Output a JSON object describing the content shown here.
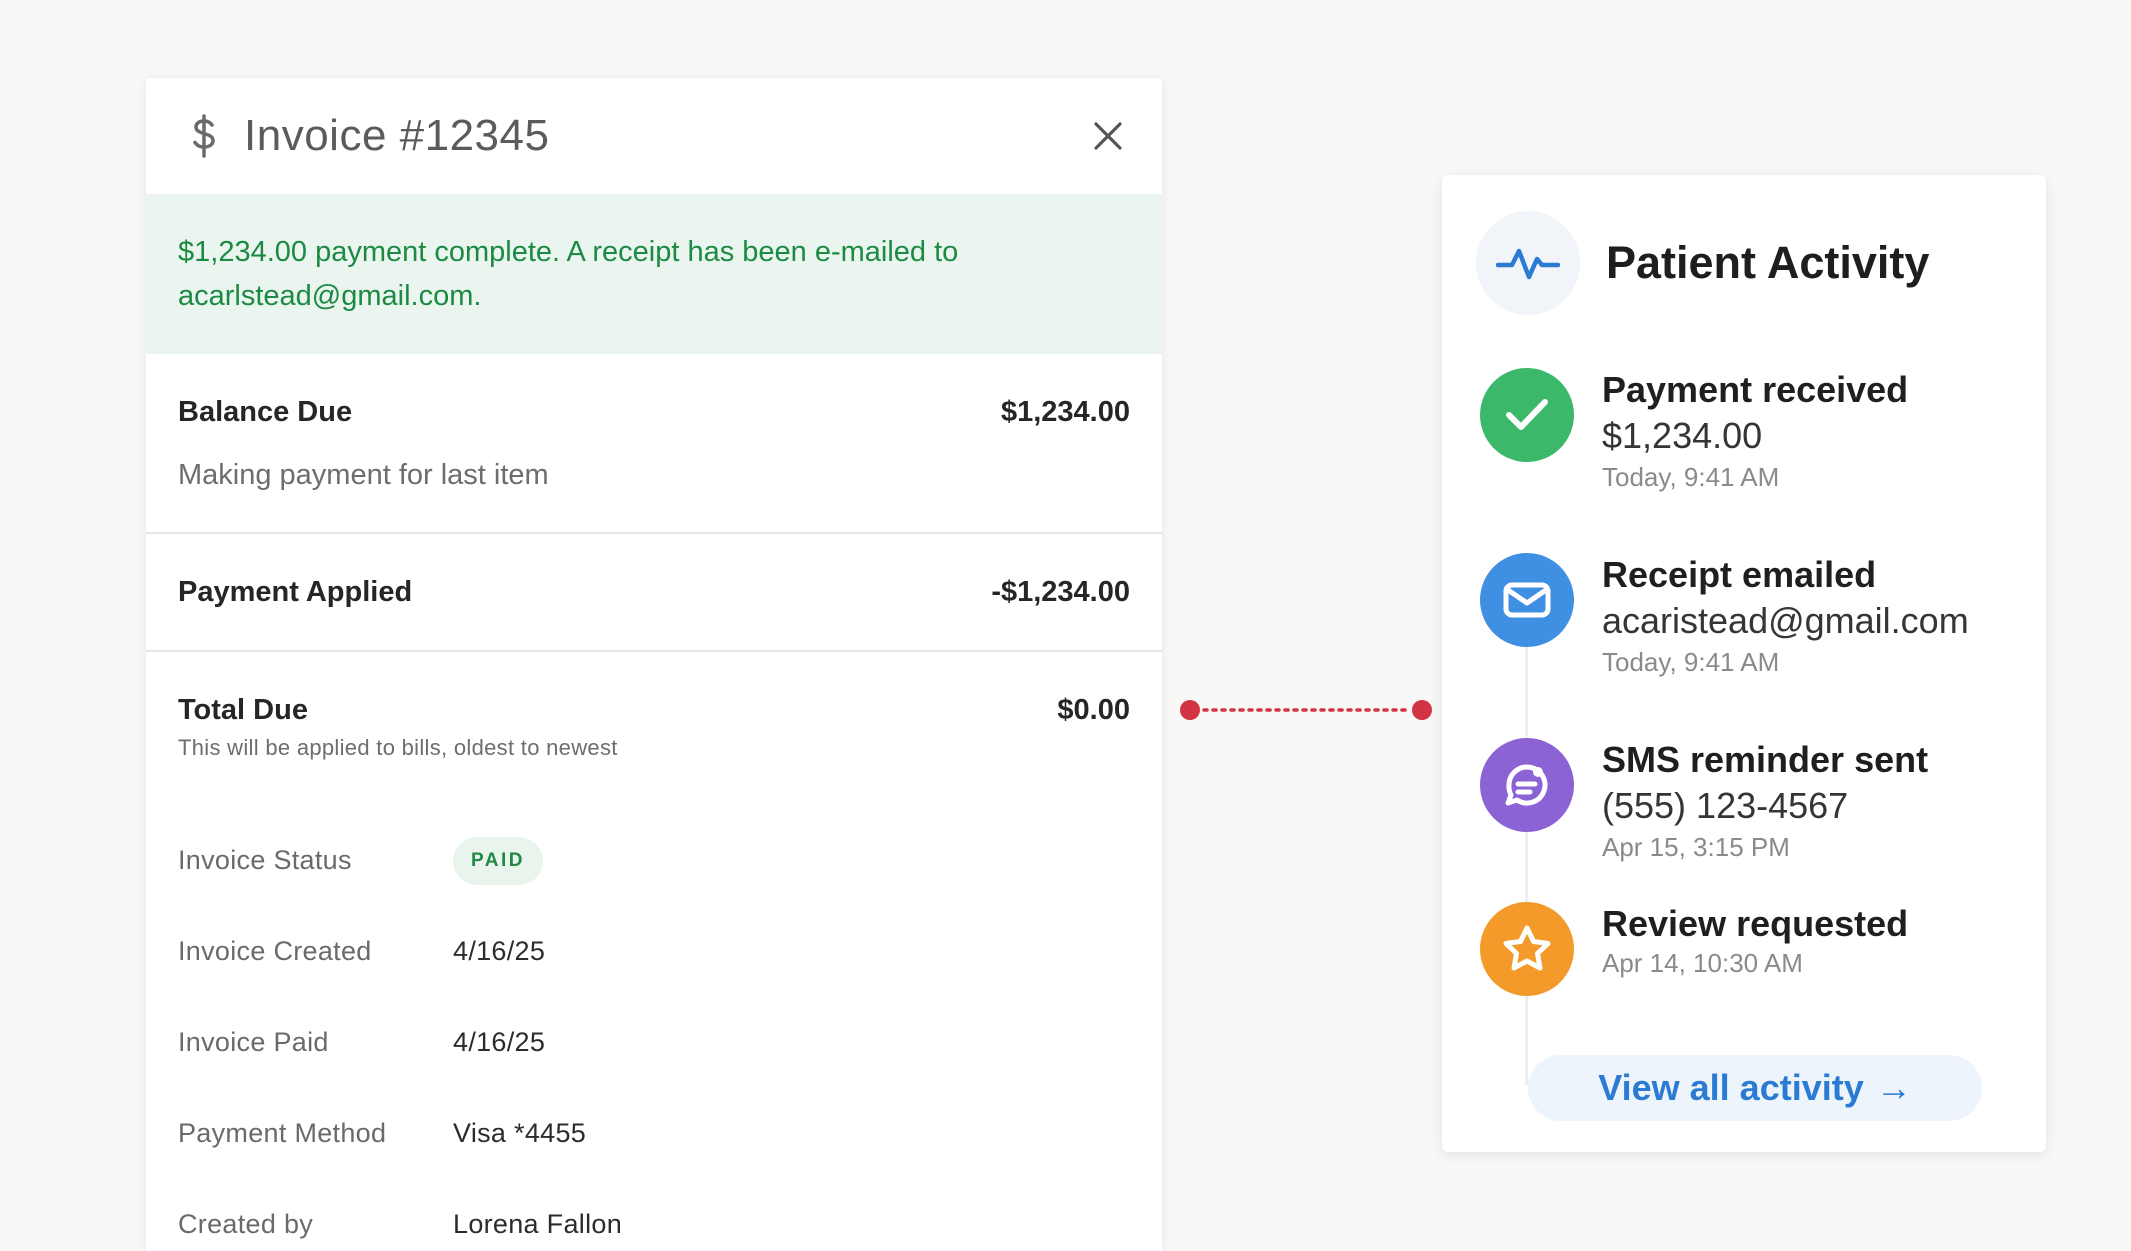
{
  "invoice": {
    "title": "Invoice #12345",
    "banner": "$1,234.00 payment complete. A receipt has been e-mailed to acarlstead@gmail.com.",
    "balance": {
      "label": "Balance Due",
      "amount": "$1,234.00",
      "note": "Making payment for last item"
    },
    "applied": {
      "label": "Payment Applied",
      "amount": "-$1,234.00"
    },
    "total": {
      "label": "Total Due",
      "amount": "$0.00",
      "note": "This will be applied to bills, oldest to newest"
    },
    "details": {
      "status_label": "Invoice Status",
      "status_value": "PAID",
      "created_label": "Invoice Created",
      "created_value": "4/16/25",
      "paid_label": "Invoice Paid",
      "paid_value": "4/16/25",
      "method_label": "Payment Method",
      "method_value": "Visa *4455",
      "creator_label": "Created by",
      "creator_value": "Lorena Fallon"
    }
  },
  "activity": {
    "title": "Patient Activity",
    "events": [
      {
        "title": "Payment received",
        "detail": "$1,234.00",
        "time": "Today, 9:41 AM",
        "icon": "check-icon",
        "color": "#3cb86b"
      },
      {
        "title": "Receipt emailed",
        "detail": "acaristead@gmail.com",
        "time": "Today, 9:41 AM",
        "icon": "mail-icon",
        "color": "#3f8fe3"
      },
      {
        "title": "SMS reminder sent",
        "detail": "(555) 123-4567",
        "time": "Apr 15, 3:15 PM",
        "icon": "chat-icon",
        "color": "#8b63d4"
      },
      {
        "title": "Review requested",
        "time": "Apr 14, 10:30 AM",
        "icon": "star-icon",
        "color": "#f39a2b"
      }
    ],
    "view_all": "View all activity",
    "view_all_arrow": "→"
  },
  "colors": {
    "success": "#1c8a43",
    "connector": "#d23444",
    "accent": "#2b7bd3"
  }
}
